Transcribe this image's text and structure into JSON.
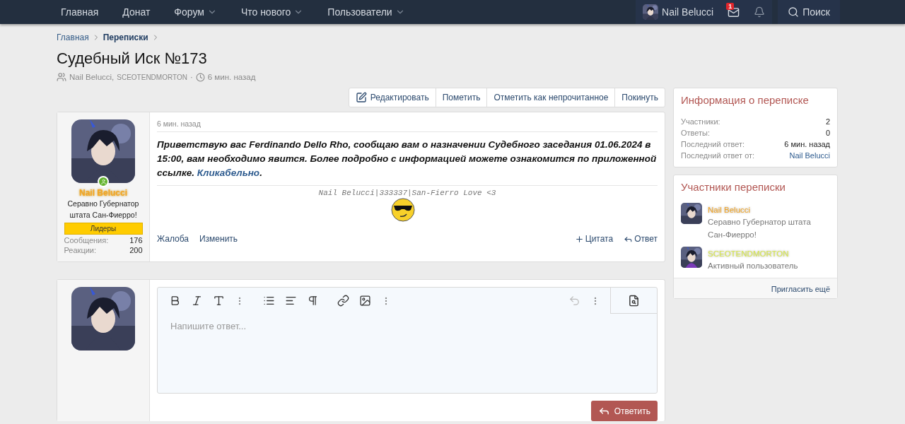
{
  "nav": {
    "items": [
      {
        "label": "Главная",
        "dropdown": false
      },
      {
        "label": "Донат",
        "dropdown": false
      },
      {
        "label": "Форум",
        "dropdown": true
      },
      {
        "label": "Что нового",
        "dropdown": true
      },
      {
        "label": "Пользователи",
        "dropdown": true
      }
    ],
    "user": "Nail Belucci",
    "messages_badge": "1",
    "search": "Поиск"
  },
  "breadcrumb": [
    {
      "label": "Главная",
      "current": false
    },
    {
      "label": "Переписки",
      "current": true
    }
  ],
  "title": "Судебный Иск №173",
  "meta": {
    "participants": [
      "Nail Belucci,",
      "SCEOTENDMORTON"
    ],
    "separator": "·",
    "time": "6 мин. назад"
  },
  "actions": [
    {
      "label": "Редактировать",
      "kind": "edit"
    },
    {
      "label": "Пометить",
      "kind": "plain"
    },
    {
      "label": "Отметить как непрочитанное",
      "kind": "plain"
    },
    {
      "label": "Покинуть",
      "kind": "plain"
    }
  ],
  "post": {
    "author": {
      "name": "Nail Belucci",
      "online": true,
      "title": "Серавно Губернатор штата Сан-Фиерро!",
      "banner": "Лидеры",
      "stats": [
        {
          "label": "Сообщения:",
          "value": "176"
        },
        {
          "label": "Реакции:",
          "value": "200"
        }
      ]
    },
    "time": "6 мин. назад",
    "body": "Приветствую вас Ferdinando Dello Rho, сообщаю вам о назначении Судебного заседания 01.06.2024 в 15:00, вам необходимо явится. Более подробно с информацией можете ознакомится по приложенной ссылке.",
    "link": "Кликабельно",
    "link_tail": ".",
    "signature": "Nail Belucci|333337|San-Fierro Love <3",
    "left_actions": [
      "Жалоба",
      "Изменить"
    ],
    "right_actions": [
      {
        "label": "Цитата",
        "kind": "quote"
      },
      {
        "label": "Ответ",
        "kind": "reply"
      }
    ]
  },
  "reply": {
    "placeholder": "Напишите ответ...",
    "button": "Ответить"
  },
  "info": {
    "title": "Информация о переписке",
    "rows": [
      {
        "label": "Участники:",
        "value": "2",
        "kind": "text"
      },
      {
        "label": "Ответы:",
        "value": "0",
        "kind": "text"
      },
      {
        "label": "Последний ответ:",
        "value": "6 мин. назад",
        "kind": "text"
      },
      {
        "label": "Последний ответ от:",
        "value": "Nail Belucci",
        "kind": "link"
      }
    ]
  },
  "members": {
    "title": "Участники переписки",
    "items": [
      {
        "name": "Nail Belucci",
        "color": "#f5a623",
        "status": "Серавно Губернатор штата Сан-Фиерро!"
      },
      {
        "name": "SCEOTENDMORTON",
        "color": "#d8e84a",
        "status": "Активный пользователь"
      }
    ],
    "invite": "Пригласить ещё"
  }
}
